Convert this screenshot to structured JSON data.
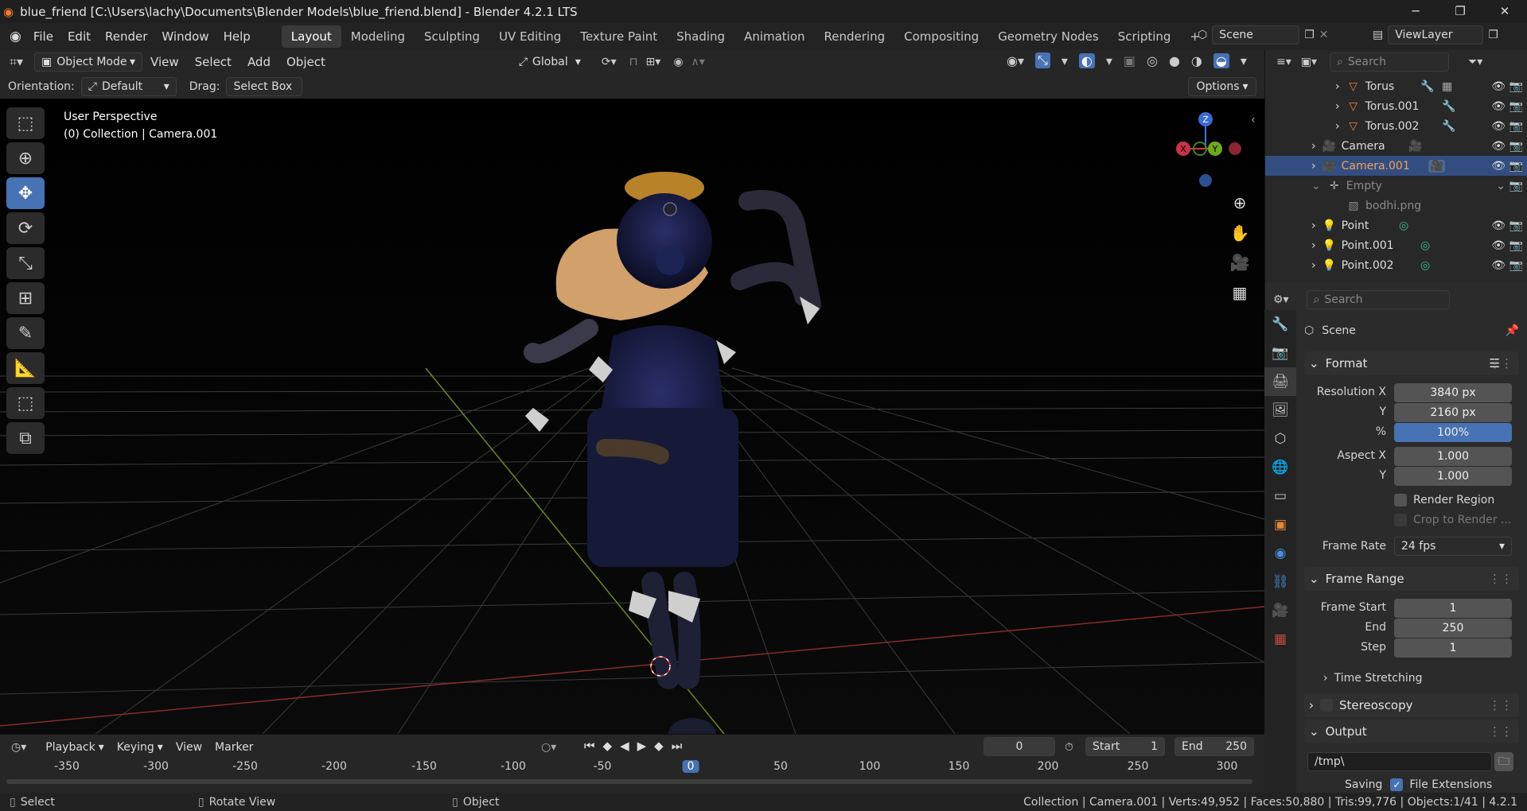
{
  "window": {
    "title": "blue_friend [C:\\Users\\lachy\\Documents\\Blender Models\\blue_friend.blend] - Blender 4.2.1 LTS",
    "minimize": "─",
    "maximize": "❐",
    "close": "✕"
  },
  "menu": {
    "items": [
      "File",
      "Edit",
      "Render",
      "Window",
      "Help"
    ],
    "workspaces": [
      "Layout",
      "Modeling",
      "Sculpting",
      "UV Editing",
      "Texture Paint",
      "Shading",
      "Animation",
      "Rendering",
      "Compositing",
      "Geometry Nodes",
      "Scripting"
    ],
    "active_workspace": "Layout",
    "add_tab": "+",
    "scene": "Scene",
    "viewlayer": "ViewLayer"
  },
  "viewport_header": {
    "mode": "Object Mode",
    "menus": [
      "View",
      "Select",
      "Add",
      "Object"
    ],
    "transform": "Global"
  },
  "tool_options": {
    "orientation_label": "Orientation:",
    "orientation": "Default",
    "drag_label": "Drag:",
    "drag": "Select Box",
    "options": "Options"
  },
  "viewport": {
    "perspective": "User Perspective",
    "context": "(0) Collection | Camera.001",
    "gizmo": {
      "x": "X",
      "y": "Y",
      "z": "Z"
    }
  },
  "outliner": {
    "search_placeholder": "Search",
    "rows": [
      "Torus",
      "Torus.001",
      "Torus.002",
      "Camera",
      "Camera.001",
      "Empty",
      "bodhi.png",
      "Point",
      "Point.001",
      "Point.002"
    ]
  },
  "properties": {
    "search_placeholder": "Search",
    "context": "Scene",
    "format": {
      "title": "Format",
      "res_x_label": "Resolution X",
      "res_x": "3840 px",
      "res_y_label": "Y",
      "res_y": "2160 px",
      "pct_label": "%",
      "pct": "100%",
      "aspect_x_label": "Aspect X",
      "aspect_x": "1.000",
      "aspect_y_label": "Y",
      "aspect_y": "1.000",
      "render_region": "Render Region",
      "crop": "Crop to Render ...",
      "frame_rate_label": "Frame Rate",
      "frame_rate": "24 fps"
    },
    "frame_range": {
      "title": "Frame Range",
      "start_label": "Frame Start",
      "start": "1",
      "end_label": "End",
      "end": "250",
      "step_label": "Step",
      "step": "1",
      "time_stretching": "Time Stretching"
    },
    "stereoscopy": "Stereoscopy",
    "output": {
      "title": "Output",
      "path": "/tmp\\",
      "saving_label": "Saving",
      "file_ext": "File Extensions"
    }
  },
  "timeline": {
    "menus": [
      "Playback",
      "Keying",
      "View",
      "Marker"
    ],
    "current_frame": "0",
    "start_label": "Start",
    "start": "1",
    "end_label": "End",
    "end": "250",
    "ruler": [
      "-350",
      "-300",
      "-250",
      "-200",
      "-150",
      "-100",
      "-50",
      "0",
      "50",
      "100",
      "150",
      "200",
      "250",
      "300"
    ]
  },
  "statusbar": {
    "select": "Select",
    "rotate": "Rotate View",
    "object": "Object",
    "info": "Collection | Camera.001 | Verts:49,952 | Faces:50,880 | Tris:99,776 | Objects:1/41 | 4.2.1"
  }
}
